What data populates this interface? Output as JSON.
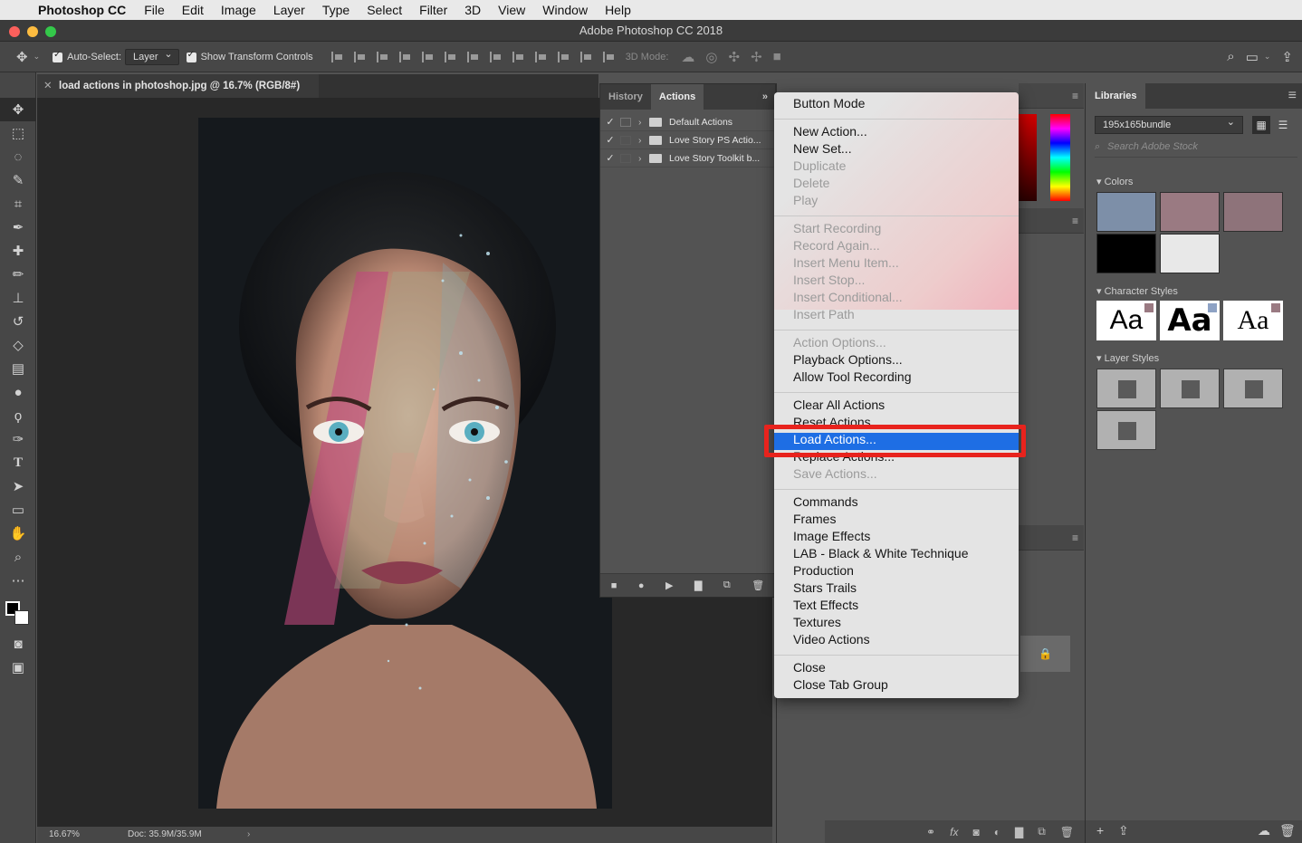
{
  "menubar": {
    "app": "Photoshop CC",
    "items": [
      "File",
      "Edit",
      "Image",
      "Layer",
      "Type",
      "Select",
      "Filter",
      "3D",
      "View",
      "Window",
      "Help"
    ]
  },
  "window": {
    "title": "Adobe Photoshop CC 2018"
  },
  "options": {
    "auto_select_label": "Auto-Select:",
    "auto_select_value": "Layer",
    "show_transform_label": "Show Transform Controls",
    "mode_3d_label": "3D Mode:"
  },
  "document": {
    "tab_title": "load actions in photoshop.jpg @ 16.7% (RGB/8#)",
    "zoom": "16.67%",
    "doc_size": "Doc: 35.9M/35.9M"
  },
  "actions_panel": {
    "tabs": [
      "History",
      "Actions"
    ],
    "rows": [
      "Default Actions",
      "Love Story PS Actio...",
      "Love Story Toolkit b..."
    ]
  },
  "menu": {
    "items": [
      {
        "label": "Button Mode",
        "enabled": true
      },
      {
        "label": "New Action...",
        "enabled": true
      },
      {
        "label": "New Set...",
        "enabled": true
      },
      {
        "label": "Duplicate",
        "enabled": false
      },
      {
        "label": "Delete",
        "enabled": false
      },
      {
        "label": "Play",
        "enabled": false
      },
      {
        "label": "Start Recording",
        "enabled": false
      },
      {
        "label": "Record Again...",
        "enabled": false
      },
      {
        "label": "Insert Menu Item...",
        "enabled": false
      },
      {
        "label": "Insert Stop...",
        "enabled": false
      },
      {
        "label": "Insert Conditional...",
        "enabled": false
      },
      {
        "label": "Insert Path",
        "enabled": false
      },
      {
        "label": "Action Options...",
        "enabled": false
      },
      {
        "label": "Playback Options...",
        "enabled": true
      },
      {
        "label": "Allow Tool Recording",
        "enabled": true
      },
      {
        "label": "Clear All Actions",
        "enabled": true
      },
      {
        "label": "Reset Actions",
        "enabled": true
      },
      {
        "label": "Load Actions...",
        "enabled": true,
        "highlighted": true
      },
      {
        "label": "Replace Actions...",
        "enabled": true
      },
      {
        "label": "Save Actions...",
        "enabled": false
      },
      {
        "label": "Commands",
        "enabled": true
      },
      {
        "label": "Frames",
        "enabled": true
      },
      {
        "label": "Image Effects",
        "enabled": true
      },
      {
        "label": "LAB - Black & White Technique",
        "enabled": true
      },
      {
        "label": "Production",
        "enabled": true
      },
      {
        "label": "Stars Trails",
        "enabled": true
      },
      {
        "label": "Text Effects",
        "enabled": true
      },
      {
        "label": "Textures",
        "enabled": true
      },
      {
        "label": "Video Actions",
        "enabled": true
      },
      {
        "label": "Close",
        "enabled": true
      },
      {
        "label": "Close Tab Group",
        "enabled": true
      }
    ]
  },
  "libraries": {
    "tab": "Libraries",
    "library": "195x165bundle",
    "search_placeholder": "Search Adobe Stock",
    "colors_label": "Colors",
    "colors": [
      "#7d8fa8",
      "#9a7a82",
      "#8e737a",
      "#000000",
      "#e8e8e8"
    ],
    "char_styles_label": "Character Styles",
    "char_style_sample": "Aa",
    "char_style_tags": [
      "#9a7a82",
      "#8ea2c4",
      "#9a7a82"
    ],
    "layer_styles_label": "Layer Styles"
  },
  "colors": {
    "accent": "#1e6ee4",
    "callout": "#e8231d"
  }
}
